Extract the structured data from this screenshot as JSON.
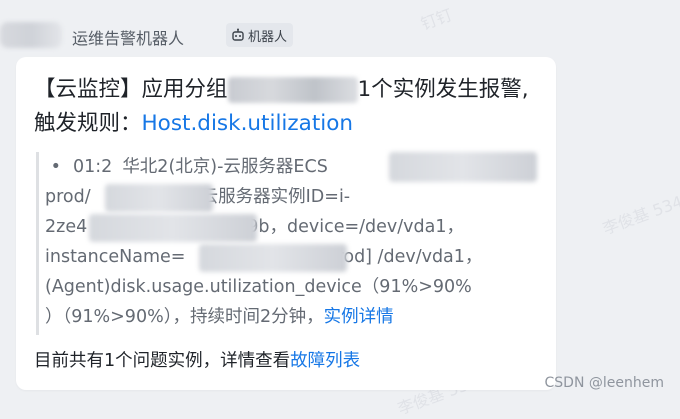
{
  "header": {
    "sender_name": "运维告警机器人",
    "bot_tag_label": "机器人",
    "bot_tag_icon": "robot-icon"
  },
  "message": {
    "title_prefix": "【云监控】应用分组",
    "title_suffix": "1个实例发生报警, 触发规则：",
    "rule_link": "Host.disk.utilization",
    "detail_line1": "01:2",
    "detail_line1b": "华北2(北京)-云服务器ECS",
    "detail_line2a": "prod/",
    "detail_line2b": "云服务器实例ID=i-",
    "detail_line3a": "2ze4",
    "detail_line3b": "9b，device=/dev/vda1，",
    "detail_line4a": "instanceName=",
    "detail_line4b": "prod] /dev/vda1，",
    "detail_line5": "(Agent)disk.usage.utilization_device（91%>90%",
    "detail_line6": "）（91%>90%），持续时间2分钟，",
    "instance_detail_link": "实例详情",
    "footer_text": "目前共有1个问题实例，详情查看",
    "fault_list_link": "故障列表"
  },
  "watermark": {
    "texts": [
      "钉钉",
      "李俊基 5349",
      "李俊基 5349"
    ]
  },
  "credit": "CSDN @leenhem",
  "colors": {
    "link": "#1677e6",
    "text_primary": "#1f2329",
    "text_secondary": "#646a73",
    "background": "#eef0f3"
  }
}
